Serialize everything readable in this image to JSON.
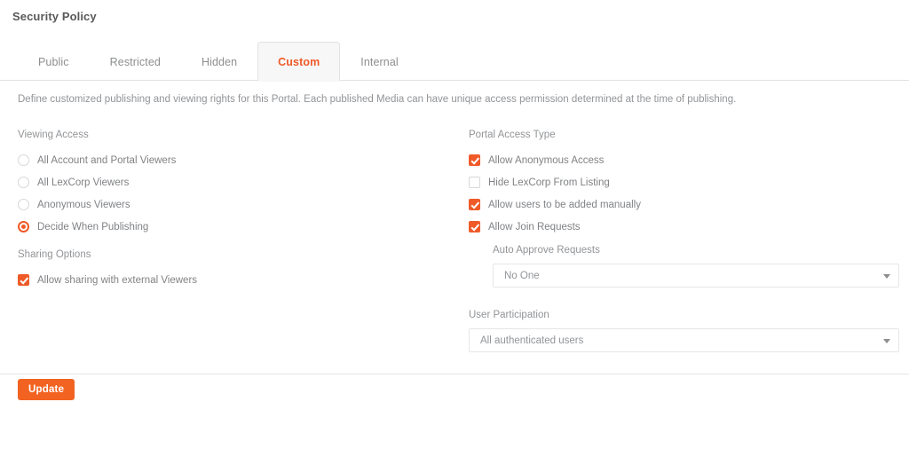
{
  "page": {
    "title": "Security Policy"
  },
  "tabs": [
    {
      "label": "Public",
      "active": false
    },
    {
      "label": "Restricted",
      "active": false
    },
    {
      "label": "Hidden",
      "active": false
    },
    {
      "label": "Custom",
      "active": true
    },
    {
      "label": "Internal",
      "active": false
    }
  ],
  "description": "Define customized publishing and viewing rights for this Portal. Each published Media can have unique access permission determined at the time of publishing.",
  "viewing_access": {
    "label": "Viewing Access",
    "options": [
      {
        "label": "All Account and Portal Viewers",
        "checked": false
      },
      {
        "label": "All LexCorp Viewers",
        "checked": false
      },
      {
        "label": "Anonymous Viewers",
        "checked": false
      },
      {
        "label": "Decide When Publishing",
        "checked": true
      }
    ]
  },
  "sharing_options": {
    "label": "Sharing Options",
    "options": [
      {
        "label": "Allow sharing with external Viewers",
        "checked": true
      }
    ]
  },
  "portal_access_type": {
    "label": "Portal Access Type",
    "options": [
      {
        "label": "Allow Anonymous Access",
        "checked": true
      },
      {
        "label": "Hide LexCorp From Listing",
        "checked": false
      },
      {
        "label": "Allow users to be added manually",
        "checked": true
      },
      {
        "label": "Allow Join Requests",
        "checked": true
      }
    ]
  },
  "auto_approve": {
    "label": "Auto Approve Requests",
    "value": "No One"
  },
  "user_participation": {
    "label": "User Participation",
    "value": "All authenticated users"
  },
  "footer": {
    "update_label": "Update"
  },
  "colors": {
    "accent": "#ef5a28",
    "button": "#f26322",
    "text": "#808285",
    "muted": "#929497",
    "border": "#e2e2e2"
  }
}
